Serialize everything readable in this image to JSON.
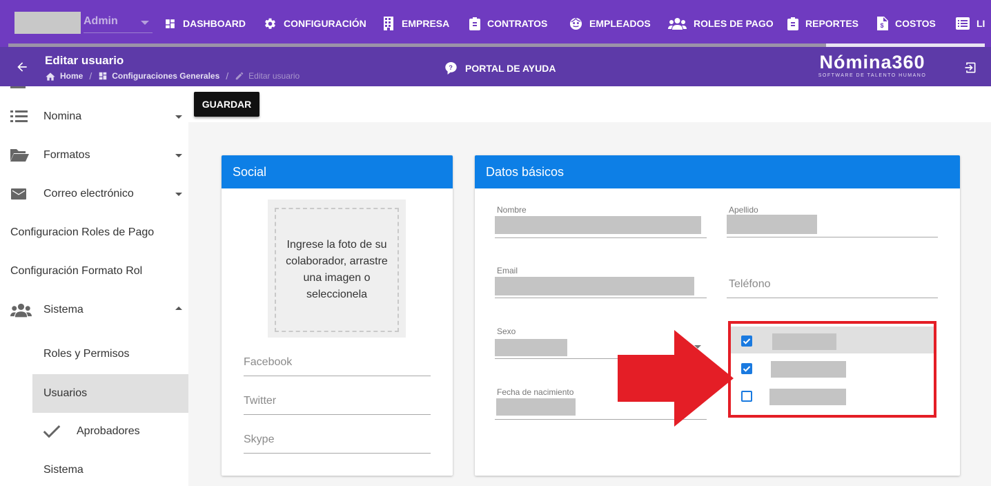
{
  "topnav": {
    "user_name": "Admin",
    "items": [
      {
        "label": "DASHBOARD",
        "icon": "dashboard-icon"
      },
      {
        "label": "CONFIGURACIÓN",
        "icon": "gear-icon"
      },
      {
        "label": "EMPRESA",
        "icon": "building-icon"
      },
      {
        "label": "CONTRATOS",
        "icon": "clipboard-icon"
      },
      {
        "label": "EMPLEADOS",
        "icon": "face-icon"
      },
      {
        "label": "ROLES DE PAGO",
        "icon": "people-icon"
      },
      {
        "label": "REPORTES",
        "icon": "clipboard-icon"
      },
      {
        "label": "COSTOS",
        "icon": "file-dollar-icon"
      },
      {
        "label": "LI",
        "icon": "list-icon"
      }
    ]
  },
  "header": {
    "title": "Editar usuario",
    "breadcrumbs": [
      "Home",
      "Configuraciones Generales",
      "Editar usuario"
    ],
    "help_label": "PORTAL DE AYUDA",
    "logo_main": "Nómina360",
    "logo_sub": "SOFTWARE DE TALENTO HUMANO"
  },
  "sidebar": {
    "items": [
      {
        "label": "Nomina",
        "icon": "list-icon",
        "expanded": false
      },
      {
        "label": "Formatos",
        "icon": "folder-open-icon",
        "expanded": false
      },
      {
        "label": "Correo electrónico",
        "icon": "mail-icon",
        "expanded": false
      },
      {
        "label": "Configuracion Roles de Pago"
      },
      {
        "label": "Configuración Formato Rol"
      },
      {
        "label": "Sistema",
        "icon": "people-icon",
        "expanded": true
      },
      {
        "label": "Roles y Permisos"
      },
      {
        "label": "Usuarios",
        "active": true
      },
      {
        "label": "Aprobadores",
        "icon": "check-icon"
      },
      {
        "label": "Sistema"
      }
    ]
  },
  "toolbar": {
    "save_label": "GUARDAR"
  },
  "social": {
    "title": "Social",
    "dropzone_text": "Ingrese la foto de su colaborador, arrastre una imagen o seleccionela",
    "facebook_placeholder": "Facebook",
    "twitter_placeholder": "Twitter",
    "skype_placeholder": "Skype"
  },
  "basic": {
    "title": "Datos básicos",
    "nombre_label": "Nombre",
    "apellido_label": "Apellido",
    "email_label": "Email",
    "telefono_placeholder": "Teléfono",
    "sexo_label": "Sexo",
    "fecha_label": "Fecha de nacimiento",
    "options": [
      {
        "checked": true
      },
      {
        "checked": true
      },
      {
        "checked": false
      }
    ]
  },
  "colors": {
    "nav_bg": "#6f3bc0",
    "header_bg": "#5d3aa8",
    "card_header": "#0d7fe6",
    "checkbox": "#1a7ae0",
    "highlight": "#e41e26"
  }
}
